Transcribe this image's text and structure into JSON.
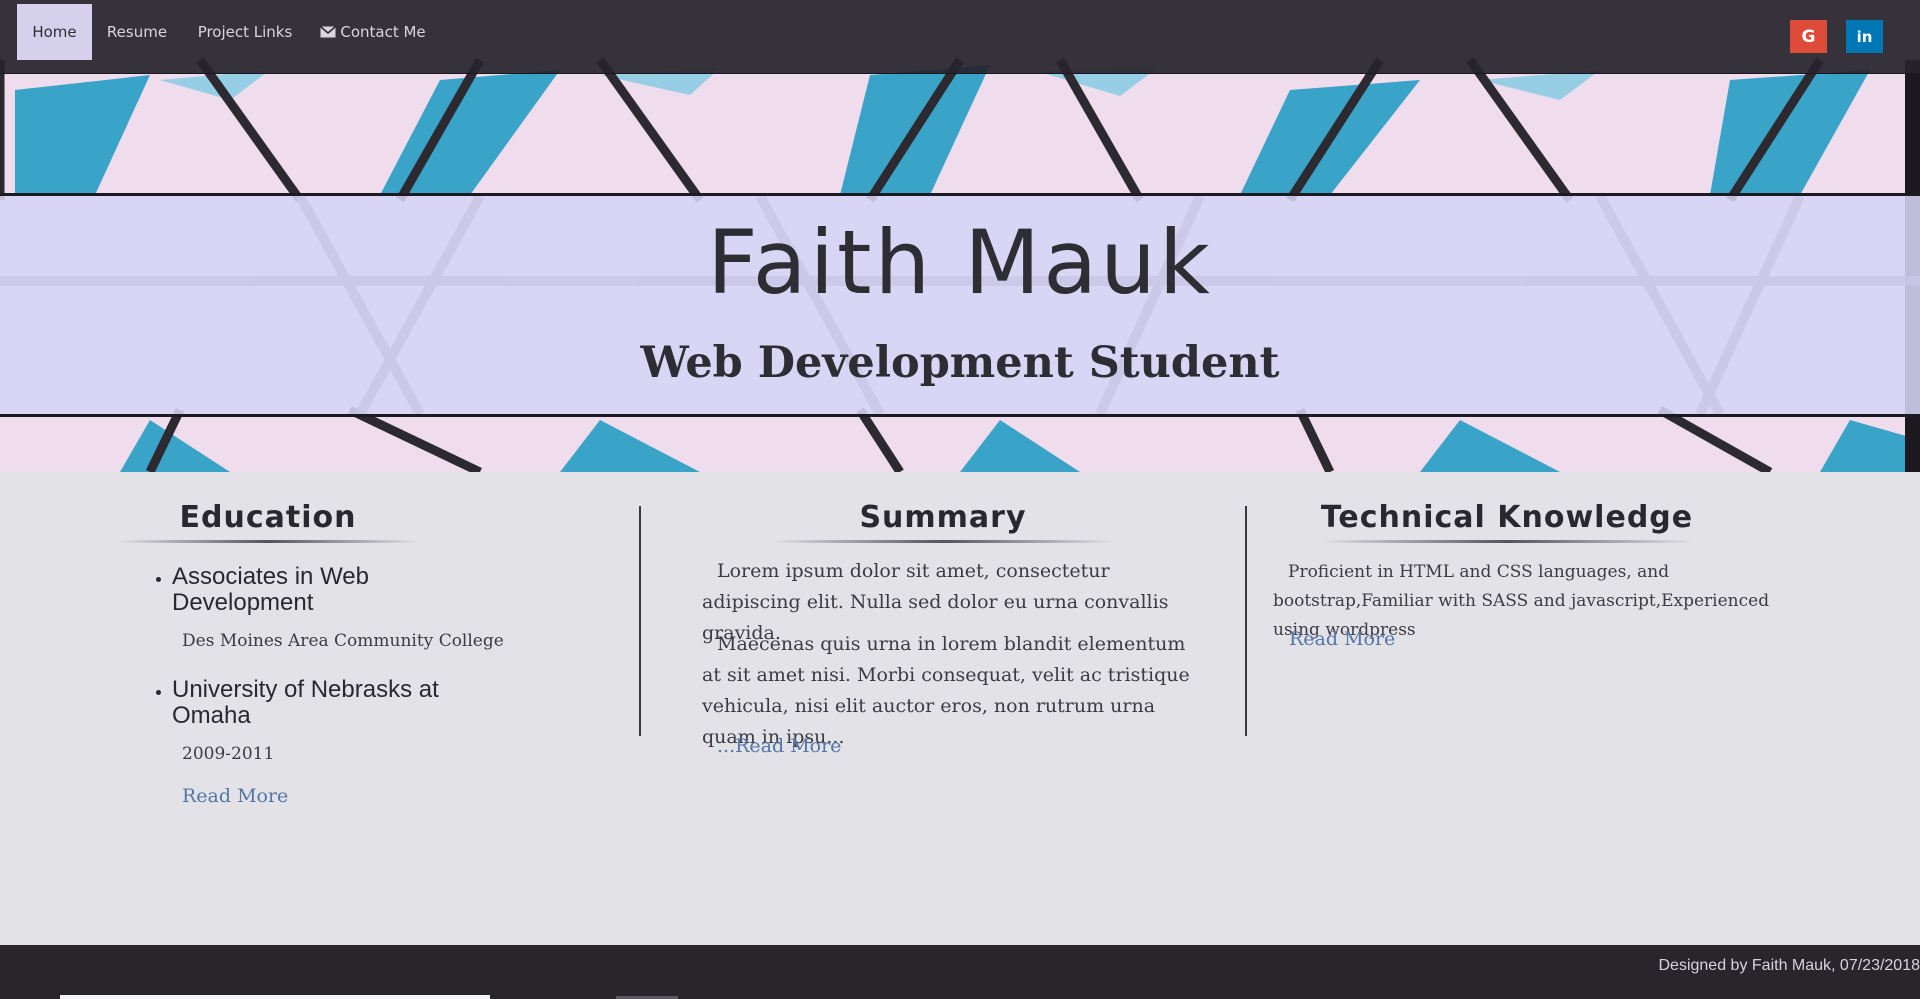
{
  "nav": {
    "items": [
      {
        "label": "Home"
      },
      {
        "label": "Resume"
      },
      {
        "label": "Project Links"
      },
      {
        "label": "Contact Me"
      }
    ],
    "social": [
      {
        "label": "G",
        "icon": "google-icon",
        "color": "#dd4b39"
      },
      {
        "label": "in",
        "icon": "linkedin-icon",
        "color": "#0077b5"
      }
    ]
  },
  "hero": {
    "name": "Faith Mauk",
    "role": "Web Development Student"
  },
  "education": {
    "title": "Education",
    "items": [
      {
        "degree": "Associates in Web Development",
        "detail": "Des Moines Area Community College"
      },
      {
        "degree": "University of Nebrasks at Omaha",
        "detail": "2009-2011"
      }
    ],
    "read_more": "Read More"
  },
  "summary": {
    "title": "Summary",
    "paragraphs": [
      "Lorem ipsum dolor sit amet, consectetur adipiscing elit. Nulla sed dolor eu urna convallis gravida.",
      "Maecenas quis urna in lorem blandit elementum at sit amet nisi. Morbi consequat, velit ac tristique vehicula, nisi elit auctor eros, non rutrum urna quam in ipsu..."
    ],
    "read_more": "...Read More"
  },
  "technical": {
    "title": "Technical Knowledge",
    "text": "Proficient in HTML and CSS languages, and bootstrap,Familiar with SASS and javascript,Experienced using wordpress",
    "read_more": "Read More"
  },
  "footer": {
    "text": "Designed by Faith Mauk, 07/23/2018"
  },
  "colors": {
    "nav_bg": "#26232b",
    "active_tab": "#d5d1ec",
    "banner": "#d6d4f5",
    "link": "#5276a8",
    "page_bg": "#e3e2e6",
    "footer_bg": "#28252b"
  }
}
